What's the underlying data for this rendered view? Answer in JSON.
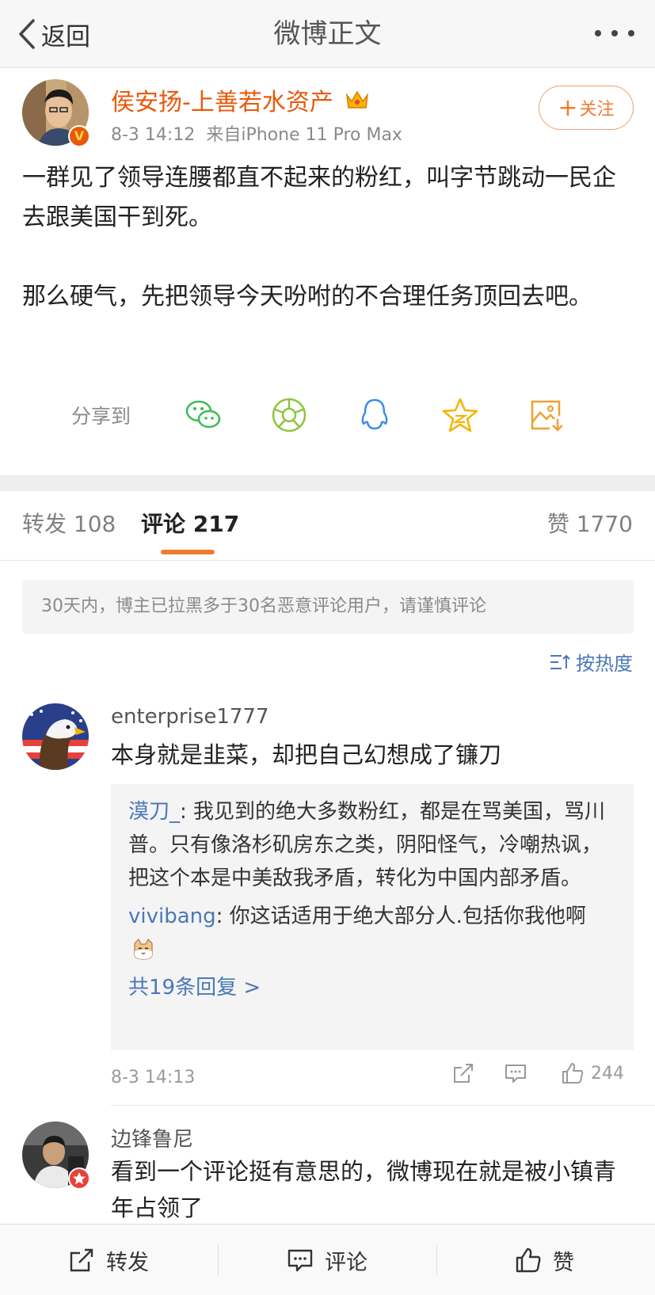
{
  "nav": {
    "back_label": "返回",
    "title": "微博正文"
  },
  "post": {
    "author": "侯安扬-上善若水资产",
    "time": "8-3 14:12",
    "source": "来自iPhone 11 Pro Max",
    "follow_label": "关注",
    "paragraphs": [
      "一群见了领导连腰都直不起来的粉红，叫字节跳动一民企去跟美国干到死。",
      "那么硬气，先把领导今天吩咐的不合理任务顶回去吧。"
    ],
    "share_label": "分享到",
    "share_icons": [
      "wechat-icon",
      "moments-icon",
      "qq-icon",
      "qzone-icon",
      "save-image-icon"
    ],
    "accent_color": "#e8590c"
  },
  "tabs": {
    "repost": "转发 108",
    "comments": "评论 217",
    "likes": "赞 1770"
  },
  "notice": "30天内，博主已拉黑多于30名恶意评论用户，请谨慎评论",
  "sort_label": "按热度",
  "comments": [
    {
      "user": "enterprise1777",
      "text": "本身就是韭菜，却把自己幻想成了镰刀",
      "replies": [
        {
          "user": "漠刀_",
          "text": ": 我见到的绝大多数粉红，都是在骂美国，骂川普。只有像洛杉矶房东之类，阴阳怪气，冷嘲热讽，把这个本是中美敌我矛盾，转化为中国内部矛盾。"
        },
        {
          "user": "vivibang",
          "text": ": 你这话适用于绝大部分人.包括你我他啊"
        }
      ],
      "more_replies": "共19条回复 >",
      "time": "8-3 14:13",
      "likes": "244"
    },
    {
      "user": "边锋鲁尼",
      "text": "看到一个评论挺有意思的，微博现在就是被小镇青年占领了"
    }
  ],
  "bottom": {
    "repost": "转发",
    "comment": "评论",
    "like": "赞"
  }
}
